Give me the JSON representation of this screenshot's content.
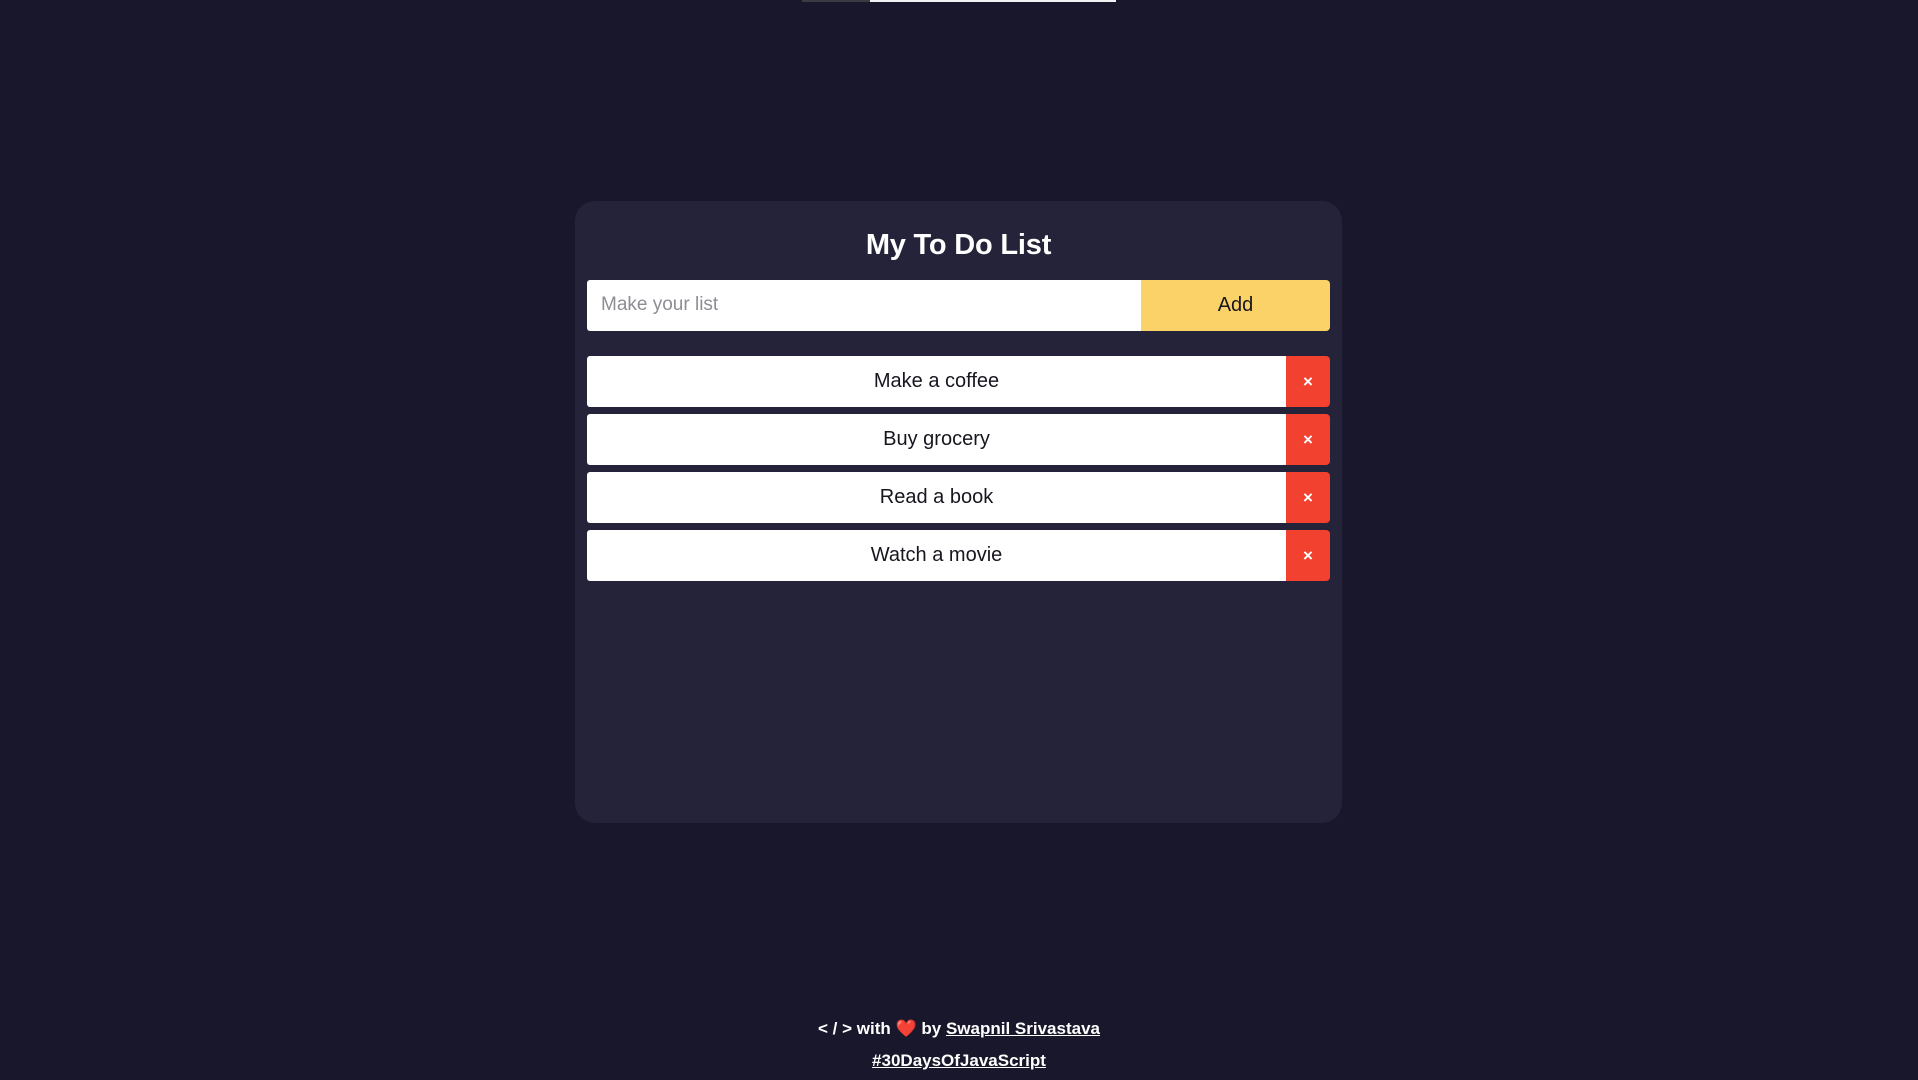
{
  "colors": {
    "page_background": "#18172b",
    "card_background": "#252339",
    "add_button": "#fbd268",
    "delete_button": "#f2412f",
    "task_background": "#ffffff",
    "text_light": "#ffffff",
    "text_dark": "#16161f",
    "placeholder": "#8d8d94"
  },
  "card": {
    "title": "My To Do List"
  },
  "input_row": {
    "value": "",
    "placeholder": "Make your list",
    "add_label": "Add"
  },
  "tasks": [
    {
      "label": "Make a coffee",
      "delete_glyph": "×"
    },
    {
      "label": "Buy grocery",
      "delete_glyph": "×"
    },
    {
      "label": "Read a book",
      "delete_glyph": "×"
    },
    {
      "label": "Watch a movie",
      "delete_glyph": "×"
    }
  ],
  "footer": {
    "code_glyph": "< / >",
    "with_text": "with",
    "heart": "❤️",
    "by_text": "by",
    "author": "Swapnil Srivastava",
    "hashtag": "#30DaysOfJavaScript"
  }
}
